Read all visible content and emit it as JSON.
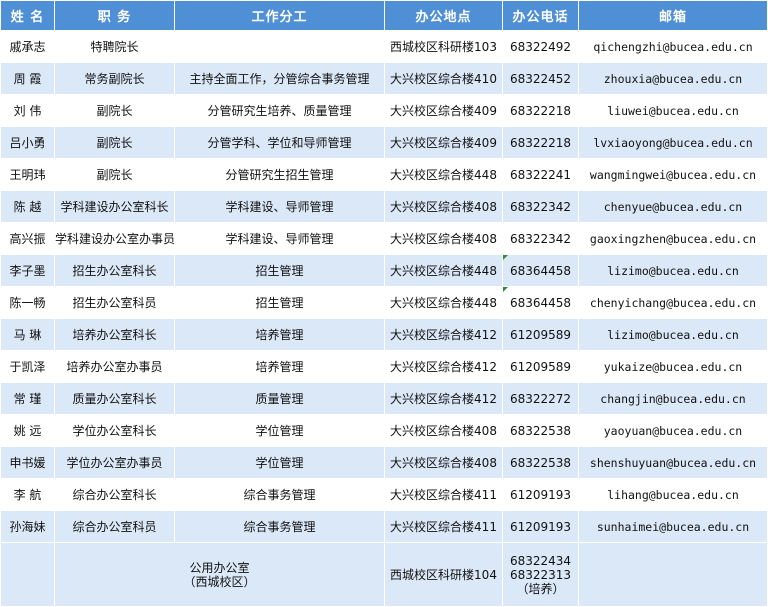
{
  "headers": {
    "name": "姓  名",
    "title": "职  务",
    "duty": "工作分工",
    "office": "办公地点",
    "phone": "办公电话",
    "email": "邮箱"
  },
  "rows": [
    {
      "name": "戚承志",
      "title": "特聘院长",
      "duty": "",
      "office": "西城校区科研楼103",
      "phone": "68322492",
      "email": "qichengzhi@bucea.edu.cn"
    },
    {
      "name": "周  霞",
      "title": "常务副院长",
      "duty": "主持全面工作，分管综合事务管理",
      "office": "大兴校区综合楼410",
      "phone": "68322452",
      "email": "zhouxia@bucea.edu.cn"
    },
    {
      "name": "刘  伟",
      "title": "副院长",
      "duty": "分管研究生培养、质量管理",
      "office": "大兴校区综合楼409",
      "phone": "68322218",
      "email": "liuwei@bucea.edu.cn"
    },
    {
      "name": "吕小勇",
      "title": "副院长",
      "duty": "分管学科、学位和导师管理",
      "office": "大兴校区综合楼409",
      "phone": "68322218",
      "email": "lvxiaoyong@bucea.edu.cn"
    },
    {
      "name": "王明玮",
      "title": "副院长",
      "duty": "分管研究生招生管理",
      "office": "大兴校区综合楼448",
      "phone": "68322241",
      "email": "wangmingwei@bucea.edu.cn"
    },
    {
      "name": "陈  越",
      "title": "学科建设办公室科长",
      "duty": "学科建设、导师管理",
      "office": "大兴校区综合楼408",
      "phone": "68322342",
      "email": "chenyue@bucea.edu.cn"
    },
    {
      "name": "高兴振",
      "title": "学科建设办公室办事员",
      "duty": "学科建设、导师管理",
      "office": "大兴校区综合楼408",
      "phone": "68322342",
      "email": "gaoxingzhen@bucea.edu.cn"
    },
    {
      "name": "李子墨",
      "title": "招生办公室科长",
      "duty": "招生管理",
      "office": "大兴校区综合楼448",
      "phone": "68364458",
      "email": "lizimo@bucea.edu.cn"
    },
    {
      "name": "陈一畅",
      "title": "招生办公室科员",
      "duty": "招生管理",
      "office": "大兴校区综合楼448",
      "phone": "68364458",
      "email": "chenyichang@bucea.edu.cn"
    },
    {
      "name": "马  琳",
      "title": "培养办公室科长",
      "duty": "培养管理",
      "office": "大兴校区综合楼412",
      "phone": "61209589",
      "email": "lizimo@bucea.edu.cn"
    },
    {
      "name": "于凯泽",
      "title": "培养办公室办事员",
      "duty": "培养管理",
      "office": "大兴校区综合楼412",
      "phone": "61209589",
      "email": "yukaize@bucea.edu.cn"
    },
    {
      "name": "常  瑾",
      "title": "质量办公室科长",
      "duty": "质量管理",
      "office": "大兴校区综合楼412",
      "phone": "68322272",
      "email": "changjin@bucea.edu.cn"
    },
    {
      "name": "姚  远",
      "title": "学位办公室科长",
      "duty": "学位管理",
      "office": "大兴校区综合楼408",
      "phone": "68322538",
      "email": "yaoyuan@bucea.edu.cn"
    },
    {
      "name": "申书媛",
      "title": "学位办公室办事员",
      "duty": "学位管理",
      "office": "大兴校区综合楼408",
      "phone": "68322538",
      "email": "shenshuyuan@bucea.edu.cn"
    },
    {
      "name": "李  航",
      "title": "综合办公室科长",
      "duty": "综合事务管理",
      "office": "大兴校区综合楼411",
      "phone": "61209193",
      "email": "lihang@bucea.edu.cn"
    },
    {
      "name": "孙海妹",
      "title": "综合办公室科员",
      "duty": "综合事务管理",
      "office": "大兴校区综合楼411",
      "phone": "61209193",
      "email": "sunhaimei@bucea.edu.cn"
    }
  ],
  "footer": {
    "label_line1": "公用办公室",
    "label_line2": "（西城校区）",
    "office": "西城校区科研楼104",
    "phone_line1": "68322434",
    "phone_line2": "68322313",
    "phone_line3": "（培养）"
  }
}
